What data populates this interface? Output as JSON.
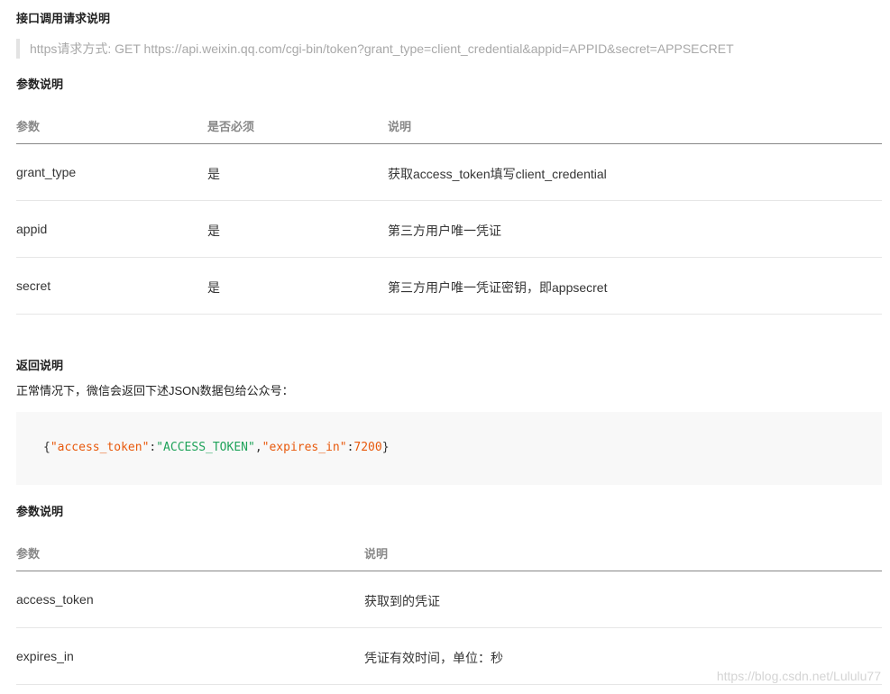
{
  "request_section": {
    "title": "接口调用请求说明",
    "quote": "https请求方式: GET https://api.weixin.qq.com/cgi-bin/token?grant_type=client_credential&appid=APPID&secret=APPSECRET"
  },
  "param_table_1": {
    "title": "参数说明",
    "headers": [
      "参数",
      "是否必须",
      "说明"
    ],
    "rows": [
      [
        "grant_type",
        "是",
        "获取access_token填写client_credential"
      ],
      [
        "appid",
        "是",
        "第三方用户唯一凭证"
      ],
      [
        "secret",
        "是",
        "第三方用户唯一凭证密钥，即appsecret"
      ]
    ]
  },
  "return_section": {
    "title": "返回说明",
    "description": "正常情况下，微信会返回下述JSON数据包给公众号：",
    "code": {
      "open": "{",
      "key1": "\"access_token\"",
      "colon1": ":",
      "val1": "\"ACCESS_TOKEN\"",
      "comma": ",",
      "key2": "\"expires_in\"",
      "colon2": ":",
      "val2": "7200",
      "close": "}"
    }
  },
  "param_table_2": {
    "title": "参数说明",
    "headers": [
      "参数",
      "说明"
    ],
    "rows": [
      [
        "access_token",
        "获取到的凭证"
      ],
      [
        "expires_in",
        "凭证有效时间，单位：秒"
      ]
    ]
  },
  "watermark": "https://blog.csdn.net/Lululu77"
}
